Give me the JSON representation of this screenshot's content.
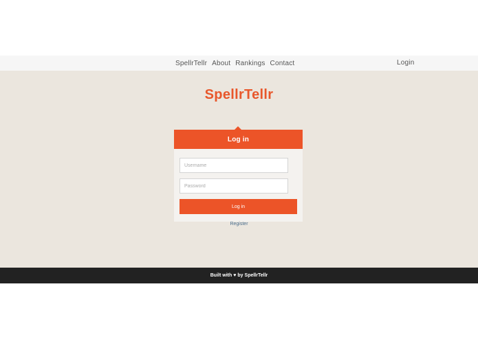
{
  "nav": {
    "links": [
      "SpellrTellr",
      "About",
      "Rankings",
      "Contact"
    ],
    "login_label": "Login"
  },
  "brand": {
    "name": "SpellrTellr"
  },
  "login_card": {
    "title": "Log in",
    "username_placeholder": "Username",
    "password_placeholder": "Password",
    "submit_label": "Log in"
  },
  "register_label": "Register",
  "footer": {
    "built_with": "Built with",
    "heart_icon": "heart-icon",
    "heart_glyph": "♥",
    "by_text": "by SpellrTellr"
  },
  "colors": {
    "accent": "#ec5428",
    "background": "#ebe6de",
    "navbar": "#f6f6f6",
    "footer": "#222222",
    "link": "#4a6d8c"
  }
}
